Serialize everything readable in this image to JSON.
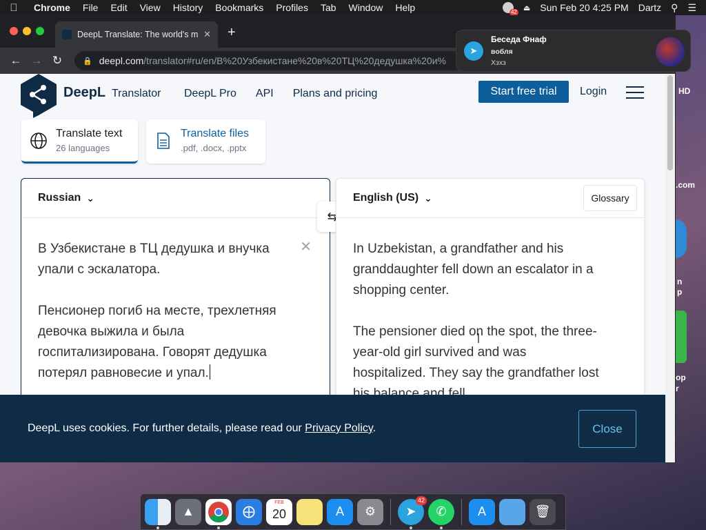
{
  "menubar": {
    "app": "Chrome",
    "items": [
      "File",
      "Edit",
      "View",
      "History",
      "Bookmarks",
      "Profiles",
      "Tab",
      "Window",
      "Help"
    ],
    "tg_badge": "42",
    "datetime": "Sun Feb 20  4:25 PM",
    "user": "Dartz"
  },
  "browser": {
    "tab_title": "DeepL Translate: The world's m",
    "url_host": "deepl.com",
    "url_path": "/translator#ru/en/В%20Узбекистане%20в%20ТЦ%20дедушка%20и%"
  },
  "notification": {
    "title": "Беседа Фнаф",
    "sender": "вобля",
    "message": "Хзхз"
  },
  "site": {
    "brand": "DeepL",
    "brand_sub": "Translator",
    "nav": [
      "DeepL Pro",
      "API",
      "Plans and pricing"
    ],
    "trial_button": "Start free trial",
    "login": "Login"
  },
  "modes": {
    "text_title": "Translate text",
    "text_sub": "26 languages",
    "files_title": "Translate files",
    "files_sub": ".pdf, .docx, .pptx"
  },
  "translator": {
    "source_lang": "Russian",
    "target_lang": "English (US)",
    "glossary": "Glossary",
    "source_text": "В Узбекистане в ТЦ дедушка и внучка\nупали с эскалатора.\n\nПенсионер погиб на месте, трехлетняя\nдевочка выжила и была\nгоспитализирована. Говорят дедушка\nпотерял равновесие и упал.",
    "target_text": "In Uzbekistan, a grandfather and his\ngranddaughter fell down an escalator in a\nshopping center.\n\nThe pensioner died on the spot, the three-\nyear-old girl survived and was\nhospitalized. They say the grandfather lost\nhis balance and fell."
  },
  "cookie": {
    "text_before": "DeepL uses cookies. For further details, please read our ",
    "link": "Privacy Policy",
    "text_after": ".",
    "close": "Close"
  },
  "desktop": {
    "labels": [
      "HD",
      ".com",
      "n",
      "p",
      "op",
      "r"
    ]
  },
  "dock": {
    "calendar_month": "FEB",
    "calendar_day": "20",
    "telegram_badge": "42"
  },
  "icons": {
    "apple": "apple-icon",
    "back": "back-arrow-icon",
    "forward": "forward-arrow-icon",
    "reload": "reload-icon",
    "lock": "lock-icon",
    "globe": "globe-icon",
    "document": "document-icon",
    "swap": "swap-icon",
    "clear": "close-icon"
  },
  "colors": {
    "brand_navy": "#0f2b46",
    "trial_blue": "#0f5e9c",
    "cookie_bg": "#0f2b46",
    "cookie_close": "#6cc0ef"
  }
}
